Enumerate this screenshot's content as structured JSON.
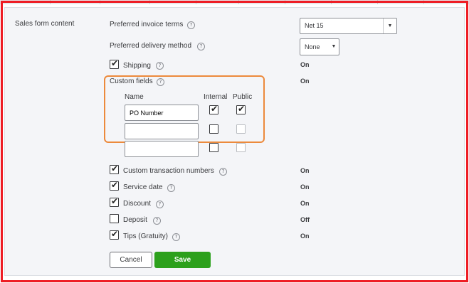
{
  "section_label": "Sales form content",
  "invoice_terms": {
    "label": "Preferred invoice terms",
    "value": "Net 15"
  },
  "delivery_method": {
    "label": "Preferred delivery method",
    "value": "None"
  },
  "shipping": {
    "label": "Shipping",
    "checked": true,
    "status": "On"
  },
  "custom_fields": {
    "label": "Custom fields",
    "status": "On",
    "col_name": "Name",
    "col_internal": "Internal",
    "col_public": "Public",
    "rows": [
      {
        "name": "PO Number",
        "internal": true,
        "public": true
      },
      {
        "name": "",
        "internal": false,
        "public": false
      },
      {
        "name": "",
        "internal": false,
        "public": false
      }
    ]
  },
  "custom_txn_numbers": {
    "label": "Custom transaction numbers",
    "checked": true,
    "status": "On"
  },
  "service_date": {
    "label": "Service date",
    "checked": true,
    "status": "On"
  },
  "discount": {
    "label": "Discount",
    "checked": true,
    "status": "On"
  },
  "deposit": {
    "label": "Deposit",
    "checked": false,
    "status": "Off"
  },
  "tips": {
    "label": "Tips (Gratuity)",
    "checked": true,
    "status": "On"
  },
  "buttons": {
    "cancel": "Cancel",
    "save": "Save"
  },
  "colors": {
    "save_green": "#2ca01c",
    "highlight_orange": "#ec8a3c",
    "frame_red": "#ee1c24"
  }
}
